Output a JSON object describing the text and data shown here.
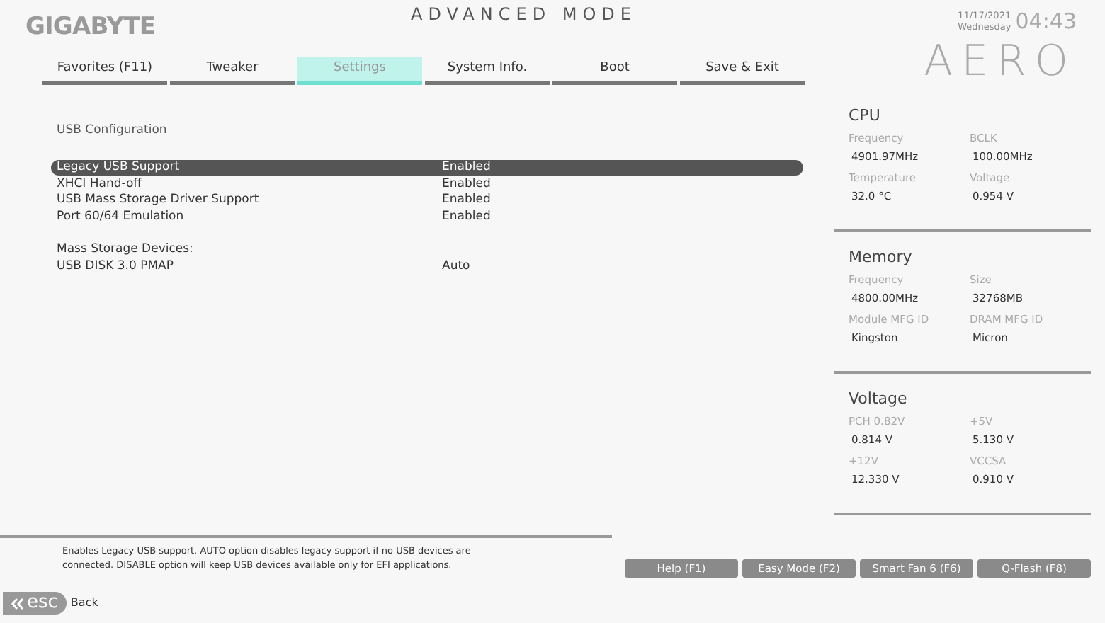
{
  "header": {
    "logo": "GIGABYTE",
    "mode_title": "ADVANCED MODE",
    "date": "11/17/2021",
    "weekday": "Wednesday",
    "time": "04:43",
    "brand": "AERO"
  },
  "tabs": [
    {
      "label": "Favorites (F11)",
      "selected": false
    },
    {
      "label": "Tweaker",
      "selected": false
    },
    {
      "label": "Settings",
      "selected": true
    },
    {
      "label": "System Info.",
      "selected": false
    },
    {
      "label": "Boot",
      "selected": false
    },
    {
      "label": "Save & Exit",
      "selected": false
    }
  ],
  "settings": {
    "section": "USB Configuration",
    "rows": [
      {
        "label": "Legacy USB Support",
        "value": "Enabled",
        "selected": true
      },
      {
        "label": "XHCI Hand-off",
        "value": "Enabled",
        "selected": false
      },
      {
        "label": "USB Mass Storage Driver Support",
        "value": "Enabled",
        "selected": false
      },
      {
        "label": "Port 60/64 Emulation",
        "value": "Enabled",
        "selected": false
      }
    ],
    "devices_heading": "Mass Storage Devices:",
    "devices": [
      {
        "label": "USB DISK 3.0 PMAP",
        "value": "Auto",
        "selected": false
      }
    ]
  },
  "info_panels": [
    {
      "title": "CPU",
      "fields": [
        {
          "label": "Frequency",
          "value": "4901.97MHz"
        },
        {
          "label": "BCLK",
          "value": "100.00MHz"
        },
        {
          "label": "Temperature",
          "value": "32.0 °C"
        },
        {
          "label": "Voltage",
          "value": "0.954 V"
        }
      ]
    },
    {
      "title": "Memory",
      "fields": [
        {
          "label": "Frequency",
          "value": "4800.00MHz"
        },
        {
          "label": "Size",
          "value": "32768MB"
        },
        {
          "label": "Module MFG ID",
          "value": "Kingston"
        },
        {
          "label": "DRAM MFG ID",
          "value": "Micron"
        }
      ]
    },
    {
      "title": "Voltage",
      "fields": [
        {
          "label": "PCH 0.82V",
          "value": "0.814 V"
        },
        {
          "label": "+5V",
          "value": "5.130 V"
        },
        {
          "label": "+12V",
          "value": "12.330 V"
        },
        {
          "label": "VCCSA",
          "value": "0.910 V"
        }
      ]
    }
  ],
  "help_text": "Enables Legacy USB support. AUTO option disables legacy support if no USB devices are connected. DISABLE option will keep USB devices available only for EFI applications.",
  "buttons": [
    "Help (F1)",
    "Easy Mode (F2)",
    "Smart Fan 6 (F6)",
    "Q-Flash (F8)"
  ],
  "back": {
    "key": "esc",
    "label": "Back"
  }
}
